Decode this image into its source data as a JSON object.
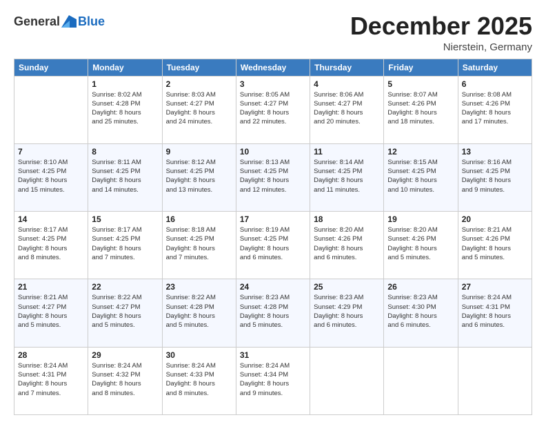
{
  "header": {
    "logo": {
      "general": "General",
      "blue": "Blue"
    },
    "title": "December 2025",
    "subtitle": "Nierstein, Germany"
  },
  "calendar": {
    "days_of_week": [
      "Sunday",
      "Monday",
      "Tuesday",
      "Wednesday",
      "Thursday",
      "Friday",
      "Saturday"
    ],
    "weeks": [
      [
        {
          "day": "",
          "info": ""
        },
        {
          "day": "1",
          "info": "Sunrise: 8:02 AM\nSunset: 4:28 PM\nDaylight: 8 hours\nand 25 minutes."
        },
        {
          "day": "2",
          "info": "Sunrise: 8:03 AM\nSunset: 4:27 PM\nDaylight: 8 hours\nand 24 minutes."
        },
        {
          "day": "3",
          "info": "Sunrise: 8:05 AM\nSunset: 4:27 PM\nDaylight: 8 hours\nand 22 minutes."
        },
        {
          "day": "4",
          "info": "Sunrise: 8:06 AM\nSunset: 4:27 PM\nDaylight: 8 hours\nand 20 minutes."
        },
        {
          "day": "5",
          "info": "Sunrise: 8:07 AM\nSunset: 4:26 PM\nDaylight: 8 hours\nand 18 minutes."
        },
        {
          "day": "6",
          "info": "Sunrise: 8:08 AM\nSunset: 4:26 PM\nDaylight: 8 hours\nand 17 minutes."
        }
      ],
      [
        {
          "day": "7",
          "info": "Sunrise: 8:10 AM\nSunset: 4:25 PM\nDaylight: 8 hours\nand 15 minutes."
        },
        {
          "day": "8",
          "info": "Sunrise: 8:11 AM\nSunset: 4:25 PM\nDaylight: 8 hours\nand 14 minutes."
        },
        {
          "day": "9",
          "info": "Sunrise: 8:12 AM\nSunset: 4:25 PM\nDaylight: 8 hours\nand 13 minutes."
        },
        {
          "day": "10",
          "info": "Sunrise: 8:13 AM\nSunset: 4:25 PM\nDaylight: 8 hours\nand 12 minutes."
        },
        {
          "day": "11",
          "info": "Sunrise: 8:14 AM\nSunset: 4:25 PM\nDaylight: 8 hours\nand 11 minutes."
        },
        {
          "day": "12",
          "info": "Sunrise: 8:15 AM\nSunset: 4:25 PM\nDaylight: 8 hours\nand 10 minutes."
        },
        {
          "day": "13",
          "info": "Sunrise: 8:16 AM\nSunset: 4:25 PM\nDaylight: 8 hours\nand 9 minutes."
        }
      ],
      [
        {
          "day": "14",
          "info": "Sunrise: 8:17 AM\nSunset: 4:25 PM\nDaylight: 8 hours\nand 8 minutes."
        },
        {
          "day": "15",
          "info": "Sunrise: 8:17 AM\nSunset: 4:25 PM\nDaylight: 8 hours\nand 7 minutes."
        },
        {
          "day": "16",
          "info": "Sunrise: 8:18 AM\nSunset: 4:25 PM\nDaylight: 8 hours\nand 7 minutes."
        },
        {
          "day": "17",
          "info": "Sunrise: 8:19 AM\nSunset: 4:25 PM\nDaylight: 8 hours\nand 6 minutes."
        },
        {
          "day": "18",
          "info": "Sunrise: 8:20 AM\nSunset: 4:26 PM\nDaylight: 8 hours\nand 6 minutes."
        },
        {
          "day": "19",
          "info": "Sunrise: 8:20 AM\nSunset: 4:26 PM\nDaylight: 8 hours\nand 5 minutes."
        },
        {
          "day": "20",
          "info": "Sunrise: 8:21 AM\nSunset: 4:26 PM\nDaylight: 8 hours\nand 5 minutes."
        }
      ],
      [
        {
          "day": "21",
          "info": "Sunrise: 8:21 AM\nSunset: 4:27 PM\nDaylight: 8 hours\nand 5 minutes."
        },
        {
          "day": "22",
          "info": "Sunrise: 8:22 AM\nSunset: 4:27 PM\nDaylight: 8 hours\nand 5 minutes."
        },
        {
          "day": "23",
          "info": "Sunrise: 8:22 AM\nSunset: 4:28 PM\nDaylight: 8 hours\nand 5 minutes."
        },
        {
          "day": "24",
          "info": "Sunrise: 8:23 AM\nSunset: 4:28 PM\nDaylight: 8 hours\nand 5 minutes."
        },
        {
          "day": "25",
          "info": "Sunrise: 8:23 AM\nSunset: 4:29 PM\nDaylight: 8 hours\nand 6 minutes."
        },
        {
          "day": "26",
          "info": "Sunrise: 8:23 AM\nSunset: 4:30 PM\nDaylight: 8 hours\nand 6 minutes."
        },
        {
          "day": "27",
          "info": "Sunrise: 8:24 AM\nSunset: 4:31 PM\nDaylight: 8 hours\nand 6 minutes."
        }
      ],
      [
        {
          "day": "28",
          "info": "Sunrise: 8:24 AM\nSunset: 4:31 PM\nDaylight: 8 hours\nand 7 minutes."
        },
        {
          "day": "29",
          "info": "Sunrise: 8:24 AM\nSunset: 4:32 PM\nDaylight: 8 hours\nand 8 minutes."
        },
        {
          "day": "30",
          "info": "Sunrise: 8:24 AM\nSunset: 4:33 PM\nDaylight: 8 hours\nand 8 minutes."
        },
        {
          "day": "31",
          "info": "Sunrise: 8:24 AM\nSunset: 4:34 PM\nDaylight: 8 hours\nand 9 minutes."
        },
        {
          "day": "",
          "info": ""
        },
        {
          "day": "",
          "info": ""
        },
        {
          "day": "",
          "info": ""
        }
      ]
    ]
  }
}
